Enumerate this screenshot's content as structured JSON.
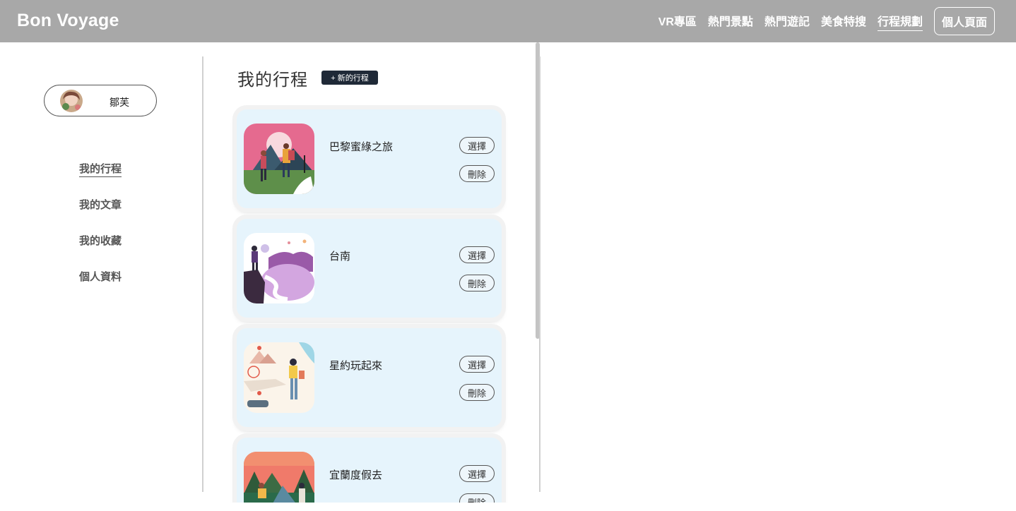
{
  "header": {
    "brand": "Bon Voyage",
    "nav": [
      "VR專區",
      "熱門景點",
      "熱門遊記",
      "美食特搜",
      "行程規劃"
    ],
    "active_nav": "行程規劃",
    "profile_button": "個人頁面"
  },
  "sidebar": {
    "user_name": "鄒芙",
    "menu": [
      "我的行程",
      "我的文章",
      "我的收藏",
      "個人資料"
    ],
    "active_menu": "我的行程"
  },
  "main": {
    "title": "我的行程",
    "new_button": "+ 新的行程",
    "trips": [
      {
        "name": "巴黎蜜綠之旅",
        "select_label": "選擇",
        "delete_label": "刪除",
        "image": "hiking-couple-illustration"
      },
      {
        "name": "台南",
        "select_label": "選擇",
        "delete_label": "刪除",
        "image": "hiker-on-cliff-illustration"
      },
      {
        "name": "星約玩起來",
        "select_label": "選擇",
        "delete_label": "刪除",
        "image": "traveler-with-map-illustration"
      },
      {
        "name": "宜蘭度假去",
        "select_label": "選擇",
        "delete_label": "刪除",
        "image": "camping-illustration"
      }
    ]
  },
  "colors": {
    "header_bg": "#a8a8a8",
    "card_bg": "#e6f4fc",
    "new_button_bg": "#1f2937"
  }
}
